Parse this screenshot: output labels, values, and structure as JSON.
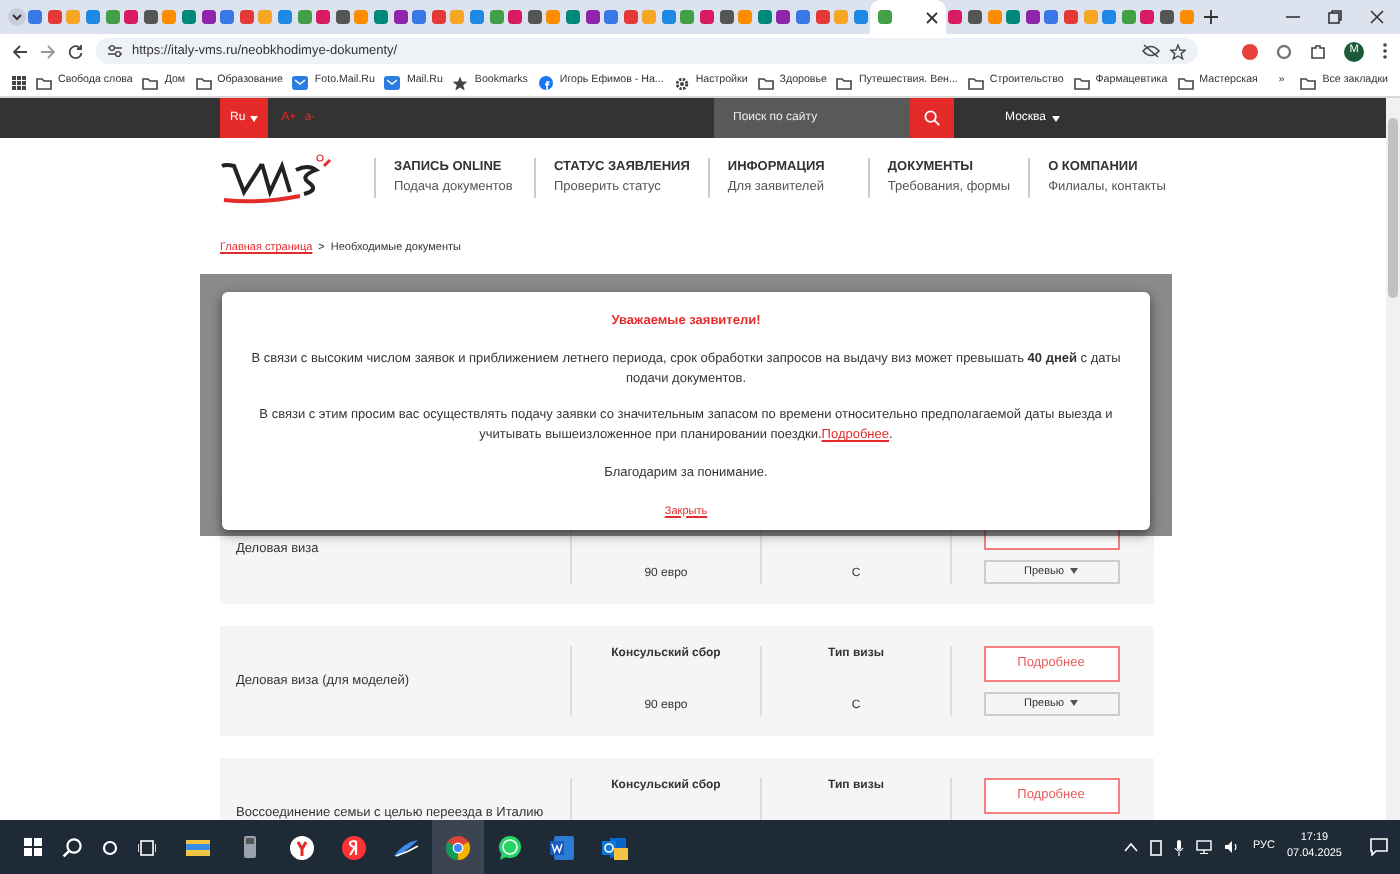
{
  "browser": {
    "tabs": [
      {
        "selected": false
      },
      {
        "selected": false
      },
      {
        "selected": false
      },
      {
        "selected": false
      },
      {
        "selected": false
      },
      {
        "selected": false
      },
      {
        "selected": false
      },
      {
        "selected": false
      },
      {
        "selected": false
      },
      {
        "selected": false
      },
      {
        "selected": false
      },
      {
        "selected": false
      },
      {
        "selected": false
      },
      {
        "selected": false
      },
      {
        "selected": false
      },
      {
        "selected": false
      },
      {
        "selected": false
      },
      {
        "selected": false
      },
      {
        "selected": false
      },
      {
        "selected": false
      },
      {
        "selected": false
      },
      {
        "selected": false
      },
      {
        "selected": false
      },
      {
        "selected": false
      },
      {
        "selected": false
      },
      {
        "selected": false
      },
      {
        "selected": false
      },
      {
        "selected": false
      },
      {
        "selected": false
      },
      {
        "selected": false
      },
      {
        "selected": false
      },
      {
        "selected": false
      },
      {
        "selected": false
      },
      {
        "selected": false
      },
      {
        "selected": false
      },
      {
        "selected": false
      },
      {
        "selected": false
      },
      {
        "selected": false
      },
      {
        "selected": false
      },
      {
        "selected": false
      },
      {
        "selected": false
      },
      {
        "selected": false
      },
      {
        "selected": false
      },
      {
        "selected": false
      },
      {
        "selected": true
      },
      {
        "selected": false
      },
      {
        "selected": false
      },
      {
        "selected": false
      },
      {
        "selected": false
      },
      {
        "selected": false
      },
      {
        "selected": false
      },
      {
        "selected": false
      },
      {
        "selected": false
      },
      {
        "selected": false
      },
      {
        "selected": false
      },
      {
        "selected": false
      },
      {
        "selected": false
      },
      {
        "selected": false
      }
    ],
    "address": "https://italy-vms.ru/neobkhodimye-dokumenty/",
    "profile_initial": "M",
    "bookmarks": [
      {
        "label": "Свобода слова",
        "kind": "folder"
      },
      {
        "label": "Дом",
        "kind": "folder"
      },
      {
        "label": "Образование",
        "kind": "folder"
      },
      {
        "label": "Foto.Mail.Ru",
        "kind": "site"
      },
      {
        "label": "Mail.Ru",
        "kind": "site"
      },
      {
        "label": "Bookmarks",
        "kind": "star"
      },
      {
        "label": "Игорь Ефимов - На...",
        "kind": "social"
      },
      {
        "label": "Настройки",
        "kind": "gear"
      },
      {
        "label": "Здоровье",
        "kind": "folder"
      },
      {
        "label": "Путешествия. Вен...",
        "kind": "folder"
      },
      {
        "label": "Строительство",
        "kind": "folder"
      },
      {
        "label": "Фармацевтика",
        "kind": "folder"
      },
      {
        "label": "Мастерская",
        "kind": "folder"
      }
    ],
    "more_bookmarks": "»",
    "all_bookmarks": "Все закладки"
  },
  "site": {
    "language": "Ru",
    "font_controls": [
      "A+",
      "a-"
    ],
    "search": {
      "placeholder": "Поиск по сайту"
    },
    "city": "Москва",
    "menu": [
      {
        "title": "ЗАПИСЬ ONLINE",
        "subtitle": "Подача документов"
      },
      {
        "title": "СТАТУС ЗАЯВЛЕНИЯ",
        "subtitle": "Проверить статус"
      },
      {
        "title": "ИНФОРМАЦИЯ",
        "subtitle": "Для заявителей"
      },
      {
        "title": "ДОКУМЕНТЫ",
        "subtitle": "Требования, формы"
      },
      {
        "title": "О КОМПАНИИ",
        "subtitle": "Филиалы, контакты"
      }
    ],
    "breadcrumb": [
      {
        "label": "Главная страница",
        "link": true
      },
      {
        "label": "Необходимые документы",
        "link": false
      }
    ],
    "breadcrumb_separator": ">",
    "documents": [
      {
        "name": "Деловая виза",
        "fee": "90 евро",
        "visa_type": "С",
        "preview_button": "Превью"
      },
      {
        "name": "Деловая виза (для моделей)",
        "fee_label": "Консульский сбор",
        "fee": "90 евро",
        "type_label": "Тип визы",
        "visa_type": "С",
        "details_button": "Подробнее",
        "preview_button": "Превью"
      },
      {
        "name": "Воссоединение семьи с целью переезда в Италию",
        "fee_label": "Консульский сбор",
        "type_label": "Тип визы",
        "details_button": "Подробнее"
      }
    ],
    "notice": {
      "title": "Уважаемые заявители!",
      "paragraphs": [
        {
          "text": "В связи с высоким числом заявок и приближением летнего периода, срок обработки запросов на выдачу виз может превышать **40 дней** с даты подачи документов."
        },
        {
          "text": "В связи с этим просим вас осуществлять подачу заявки со значительным запасом по времени относительно предполагаемой даты выезда и учитывать вышеизложенное при планировании поездки.",
          "link": "Подробнее",
          "after": "."
        }
      ],
      "thanks": "Благодарим за понимание.",
      "close": "Закрыть"
    }
  },
  "taskbar": {
    "apps": [
      {
        "kind": "explorer",
        "selected": false
      },
      {
        "kind": "usb",
        "selected": false
      },
      {
        "kind": "yandex-browser",
        "selected": false
      },
      {
        "kind": "yandex",
        "selected": false
      },
      {
        "kind": "wing",
        "selected": false
      },
      {
        "kind": "chrome",
        "selected": true
      },
      {
        "kind": "whatsapp",
        "selected": false
      },
      {
        "kind": "word",
        "selected": false
      },
      {
        "kind": "outlook",
        "selected": false
      }
    ],
    "language": "РУС",
    "time": "17:19",
    "date": "07.04.2025"
  }
}
